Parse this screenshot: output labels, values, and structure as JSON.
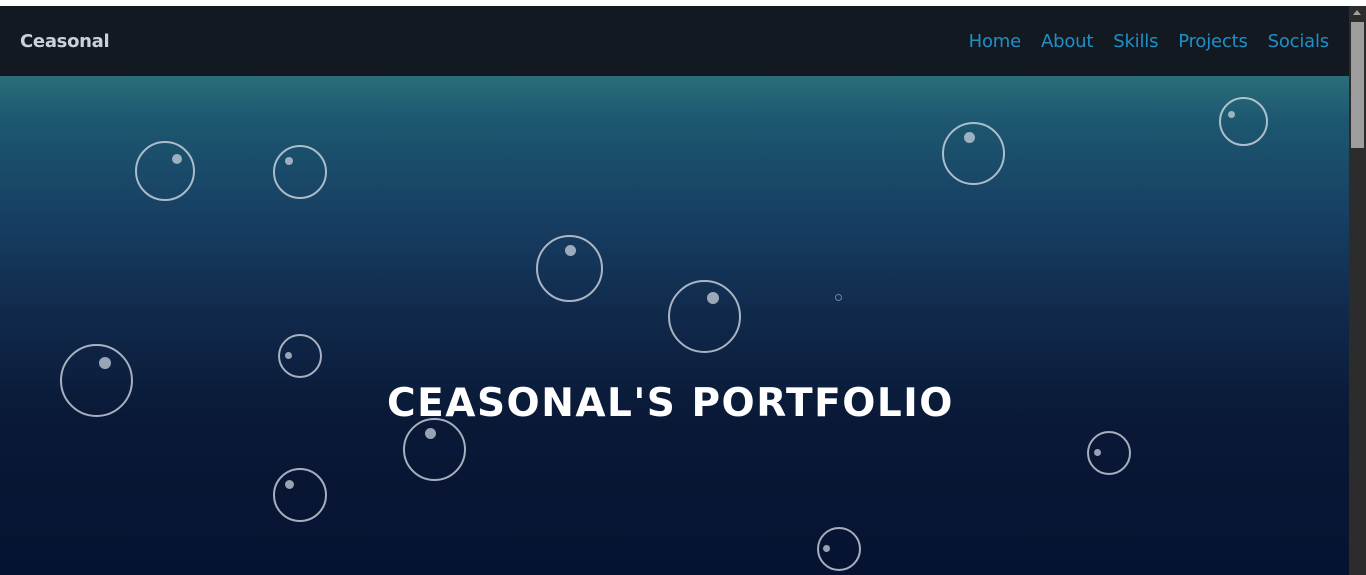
{
  "navbar": {
    "brand": "Ceasonal",
    "links": [
      "Home",
      "About",
      "Skills",
      "Projects",
      "Socials"
    ]
  },
  "hero": {
    "title": "CEASONAL'S PORTFOLIO"
  },
  "colors": {
    "navbar_bg": "#131921",
    "brand_text": "#c9d1d9",
    "nav_link": "#1e90c8",
    "hero_gradient_top": "#2a6e79",
    "hero_gradient_bottom": "#061231",
    "title_text": "#ffffff"
  },
  "icons": [
    "bubble-icon",
    "scroll-up-arrow-icon"
  ]
}
